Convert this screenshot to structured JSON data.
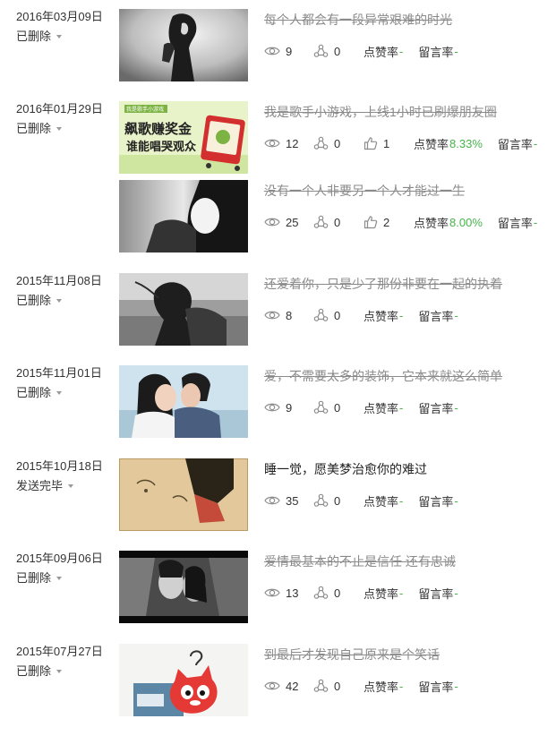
{
  "groups": [
    {
      "date": "2016年03月09日",
      "status": "已删除",
      "posts": [
        {
          "title": "每个人都会有一段异常艰难的时光",
          "deleted": true,
          "reads": "9",
          "shares": "0",
          "likes": null,
          "like_label": "点赞率",
          "like_rate": "-",
          "comment_label": "留言率",
          "comment_rate": "-"
        }
      ]
    },
    {
      "date": "2016年01月29日",
      "status": "已删除",
      "posts": [
        {
          "title": "我是歌手小游戏，上线1小时已刷爆朋友圈",
          "deleted": true,
          "reads": "12",
          "shares": "0",
          "likes": "1",
          "like_label": "点赞率",
          "like_rate": "8.33%",
          "comment_label": "留言率",
          "comment_rate": "-"
        },
        {
          "title": "没有一个人非要另一个人才能过一生",
          "deleted": true,
          "reads": "25",
          "shares": "0",
          "likes": "2",
          "like_label": "点赞率",
          "like_rate": "8.00%",
          "comment_label": "留言率",
          "comment_rate": "-"
        }
      ]
    },
    {
      "date": "2015年11月08日",
      "status": "已删除",
      "posts": [
        {
          "title": "还爱着你，只是少了那份非要在一起的执着",
          "deleted": true,
          "reads": "8",
          "shares": "0",
          "likes": null,
          "like_label": "点赞率",
          "like_rate": "-",
          "comment_label": "留言率",
          "comment_rate": "-"
        }
      ]
    },
    {
      "date": "2015年11月01日",
      "status": "已删除",
      "posts": [
        {
          "title": "爱，不需要太多的装饰，它本来就这么简单",
          "deleted": true,
          "reads": "9",
          "shares": "0",
          "likes": null,
          "like_label": "点赞率",
          "like_rate": "-",
          "comment_label": "留言率",
          "comment_rate": "-"
        }
      ]
    },
    {
      "date": "2015年10月18日",
      "status": "发送完毕",
      "posts": [
        {
          "title": "睡一觉，愿美梦治愈你的难过",
          "deleted": false,
          "reads": "35",
          "shares": "0",
          "likes": null,
          "like_label": "点赞率",
          "like_rate": "-",
          "comment_label": "留言率",
          "comment_rate": "-"
        }
      ]
    },
    {
      "date": "2015年09月06日",
      "status": "已删除",
      "posts": [
        {
          "title": "爱情最基本的不止是信任 还有忠诚",
          "deleted": true,
          "reads": "13",
          "shares": "0",
          "likes": null,
          "like_label": "点赞率",
          "like_rate": "-",
          "comment_label": "留言率",
          "comment_rate": "-"
        }
      ]
    },
    {
      "date": "2015年07月27日",
      "status": "已删除",
      "posts": [
        {
          "title": "到最后才发现自己原来是个笑话",
          "deleted": true,
          "reads": "42",
          "shares": "0",
          "likes": null,
          "like_label": "点赞率",
          "like_rate": "-",
          "comment_label": "留言率",
          "comment_rate": "-"
        }
      ]
    }
  ],
  "thumbnail_banner": {
    "tag": "我是歌手小游戏",
    "line1": "飙歌赚奖金",
    "line2": "谁能唱哭观众"
  },
  "icons": {
    "reads": "eye-icon",
    "shares": "share-icon",
    "likes": "thumbs-up-icon"
  },
  "colors": {
    "rate_value": "#44b549",
    "deleted_text": "#8a8a8a",
    "caret": "#999999"
  }
}
